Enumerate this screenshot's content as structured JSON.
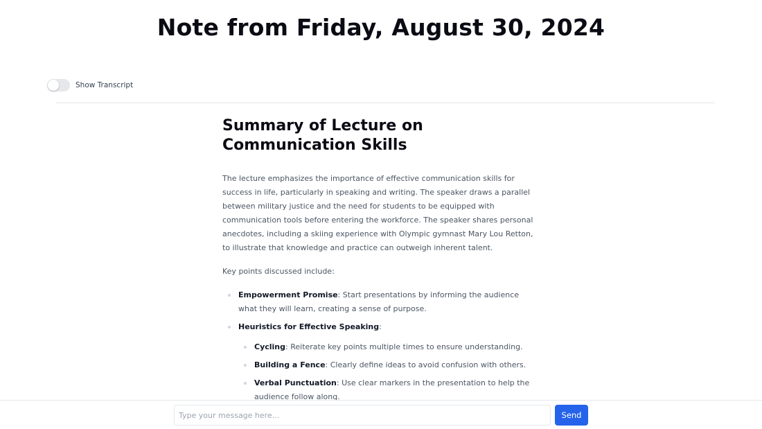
{
  "page": {
    "title": "Note from Friday, August 30, 2024"
  },
  "transcript_toggle": {
    "label": "Show Transcript",
    "state": "off"
  },
  "summary": {
    "title": "Summary of Lecture on Communication Skills",
    "paragraph": "The lecture emphasizes the importance of effective communication skills for success in life, particularly in speaking and writing. The speaker draws a parallel between military justice and the need for students to be equipped with communication tools before entering the workforce. The speaker shares personal anecdotes, including a skiing experience with Olympic gymnast Mary Lou Retton, to illustrate that knowledge and practice can outweigh inherent talent.",
    "key_points_intro": "Key points discussed include:",
    "points": [
      {
        "term": "Empowerment Promise",
        "text": ": Start presentations by informing the audience what they will learn, creating a sense of purpose."
      },
      {
        "term": "Heuristics for Effective Speaking",
        "text": ":",
        "subpoints": [
          {
            "term": "Cycling",
            "text": ": Reiterate key points multiple times to ensure understanding."
          },
          {
            "term": "Building a Fence",
            "text": ": Clearly define ideas to avoid confusion with others."
          },
          {
            "term": "Verbal Punctuation",
            "text": ": Use clear markers in the presentation to help the audience follow along."
          }
        ]
      }
    ]
  },
  "chat": {
    "placeholder": "Type your message here...",
    "value": "",
    "send_label": "Send"
  },
  "colors": {
    "accent": "#2563eb",
    "heading": "#0b0b14",
    "body_text": "#4b5563",
    "divider": "#e5e7eb"
  }
}
